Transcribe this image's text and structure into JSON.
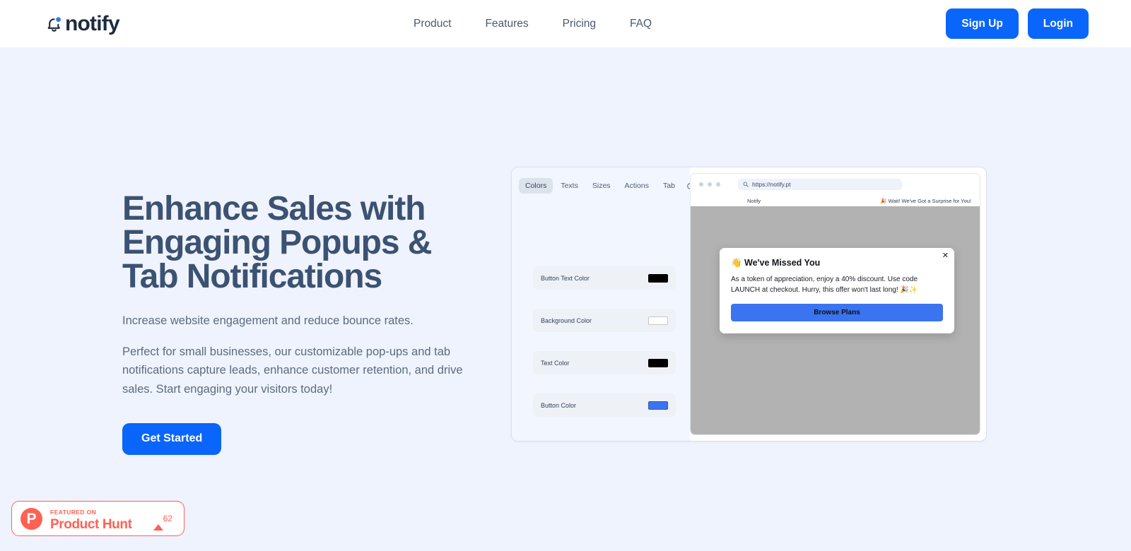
{
  "header": {
    "logo_text": "notify",
    "nav": [
      {
        "label": "Product"
      },
      {
        "label": "Features"
      },
      {
        "label": "Pricing"
      },
      {
        "label": "FAQ"
      }
    ],
    "signup_label": "Sign Up",
    "login_label": "Login"
  },
  "hero": {
    "title": "Enhance Sales with Engaging Popups & Tab Notifications",
    "subtitle": "Increase website engagement and reduce bounce rates.",
    "body": "Perfect for small businesses, our customizable pop-ups and tab notifications capture leads, enhance customer retention, and drive sales. Start engaging your visitors today!",
    "cta_label": "Get Started"
  },
  "product_hunt": {
    "mark": "P",
    "featured_label": "FEATURED ON",
    "name": "Product Hunt",
    "upvotes": "62",
    "color": "#ff6154"
  },
  "mockup": {
    "settings": {
      "tabs": [
        {
          "label": "Colors",
          "active": true
        },
        {
          "label": "Texts",
          "active": false
        },
        {
          "label": "Sizes",
          "active": false
        },
        {
          "label": "Actions",
          "active": false
        },
        {
          "label": "Tab",
          "active": false
        }
      ],
      "refresh_icon": "refresh-icon",
      "color_rows": [
        {
          "label": "Button Text Color",
          "value": "#000000"
        },
        {
          "label": "Background Color",
          "value": "#ffffff"
        },
        {
          "label": "Text Color",
          "value": "#000000"
        },
        {
          "label": "Button Color",
          "value": "#3b74f0"
        }
      ]
    },
    "browser": {
      "url": "https://notify.pt",
      "search_icon": "search-icon",
      "tab_title": "Notify",
      "tab_notification": "🎉 Wait! We've Got a Surprise for You!",
      "popup": {
        "title": "👋 We've Missed You",
        "body": "As a token of appreciation, enjoy a 40% discount. Use code LAUNCH at checkout. Hurry, this offer won't last long! 🎉✨",
        "button_label": "Browse Plans",
        "close_label": "✕"
      }
    }
  },
  "colors": {
    "accent": "#0a66fb",
    "page_bg": "#eff3fd",
    "heading": "#3c5272"
  }
}
